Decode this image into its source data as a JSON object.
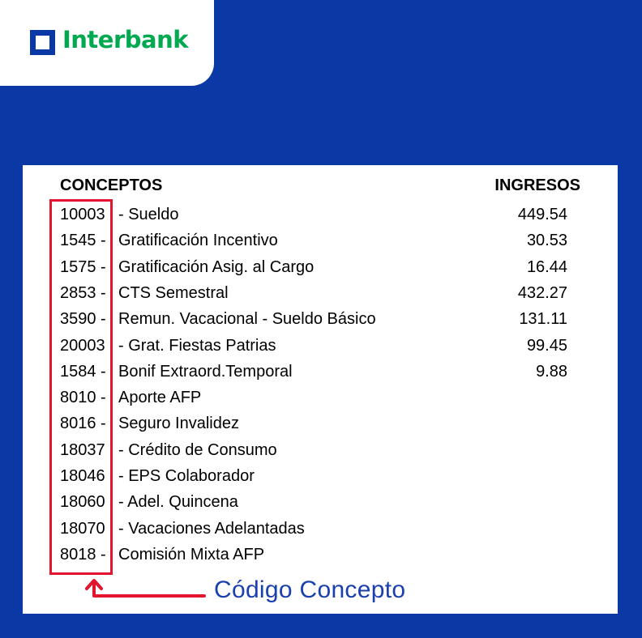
{
  "brand": {
    "name": "Interbank",
    "text_color": "#00a94f",
    "mark_color": "#0a39a6",
    "background": "#0a39a6"
  },
  "table": {
    "header_concepts": "CONCEPTOS",
    "header_income": "INGRESOS",
    "rows": [
      {
        "code": "10003",
        "desc": "- Sueldo",
        "amount": "449.54"
      },
      {
        "code": "1545 -",
        "desc": "Gratificación Incentivo",
        "amount": "30.53"
      },
      {
        "code": "1575 -",
        "desc": "Gratificación Asig. al Cargo",
        "amount": "16.44"
      },
      {
        "code": "2853 -",
        "desc": "CTS Semestral",
        "amount": "432.27"
      },
      {
        "code": "3590 -",
        "desc": "Remun. Vacacional - Sueldo Básico",
        "amount": "131.11"
      },
      {
        "code": "20003",
        "desc": "- Grat. Fiestas Patrias",
        "amount": "99.45"
      },
      {
        "code": "1584 -",
        "desc": "Bonif Extraord.Temporal",
        "amount": "9.88"
      },
      {
        "code": "8010 -",
        "desc": "Aporte AFP",
        "amount": ""
      },
      {
        "code": "8016 -",
        "desc": "Seguro Invalidez",
        "amount": ""
      },
      {
        "code": "18037",
        "desc": "- Crédito de Consumo",
        "amount": ""
      },
      {
        "code": "18046",
        "desc": "- EPS Colaborador",
        "amount": ""
      },
      {
        "code": "18060",
        "desc": "- Adel. Quincena",
        "amount": ""
      },
      {
        "code": "18070",
        "desc": "- Vacaciones Adelantadas",
        "amount": ""
      },
      {
        "code": "8018 -",
        "desc": "Comisión Mixta AFP",
        "amount": ""
      }
    ]
  },
  "annotation": {
    "caption": "Código Concepto",
    "highlight_color": "#e3142d",
    "caption_color": "#1a3fae",
    "icon": "arrow-up-left-icon"
  }
}
